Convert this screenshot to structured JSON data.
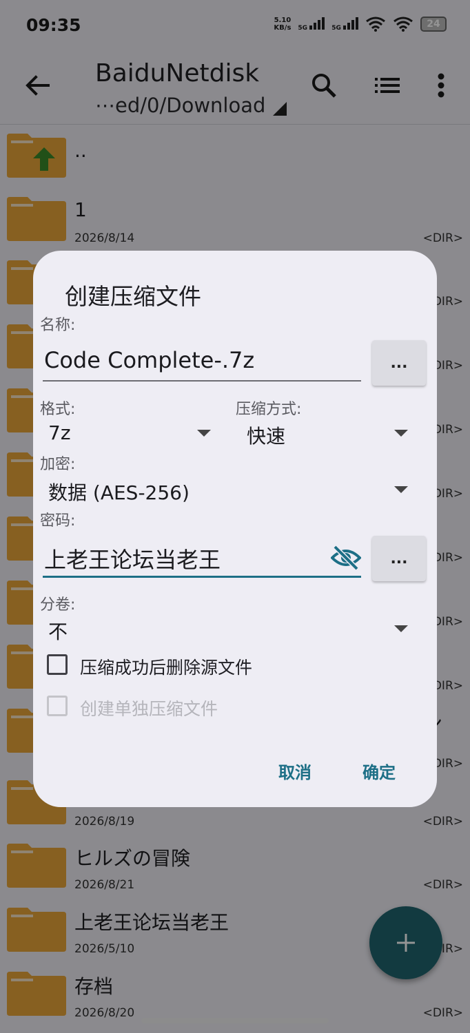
{
  "status_bar": {
    "time": "09:35",
    "net_speed_value": "5.10",
    "net_speed_unit": "KB/s",
    "signal1": "5G",
    "signal2": "5G",
    "battery": "24"
  },
  "toolbar": {
    "title": "BaiduNetdisk",
    "path": "⋯ed/0/Download",
    "icons": [
      "back-arrow-icon",
      "search-icon",
      "list-view-icon",
      "more-vert-icon"
    ]
  },
  "files": [
    {
      "name": "..",
      "date": "",
      "tag": ""
    },
    {
      "name": "1",
      "date": "2026/8/14",
      "tag": "<DIR>"
    },
    {
      "name": "",
      "date": "",
      "tag": "<DIR>"
    },
    {
      "name": "",
      "date": "",
      "tag": "<DIR>"
    },
    {
      "name": "",
      "date": "",
      "tag": "<DIR>"
    },
    {
      "name": "",
      "date": "",
      "tag": "<DIR>"
    },
    {
      "name": "",
      "date": "",
      "tag": "<DIR>"
    },
    {
      "name": "",
      "date": "",
      "tag": "<DIR>"
    },
    {
      "name": "ン",
      "date": "",
      "tag": "<DIR>"
    },
    {
      "name": "",
      "date": "",
      "tag": "<DIR>"
    },
    {
      "name": "",
      "date": "2026/8/19",
      "tag": "<DIR>"
    },
    {
      "name": "ヒルズの冒険",
      "date": "2026/8/21",
      "tag": "<DIR>"
    },
    {
      "name": "上老王论坛当老王",
      "date": "2026/5/10",
      "tag": "<DIR>"
    },
    {
      "name": "存档",
      "date": "2026/8/20",
      "tag": "<DIR>"
    }
  ],
  "dialog": {
    "title": "创建压缩文件",
    "name_label": "名称:",
    "name_value": "Code Complete-.7z",
    "dots": "...",
    "format_label": "格式:",
    "format_value": "7z",
    "method_label": "压缩方式:",
    "method_value": "快速",
    "encrypt_label": "加密:",
    "encrypt_value": "数据 (AES-256)",
    "password_label": "密码:",
    "password_value": "上老王论坛当老王",
    "split_label": "分卷:",
    "split_value": "不",
    "delete_source_label": "压缩成功后删除源文件",
    "delete_source_checked": false,
    "separate_label": "创建单独压缩文件",
    "separate_enabled": false,
    "cancel_label": "取消",
    "ok_label": "确定"
  },
  "colors": {
    "accent": "#1d6f86",
    "fab": "#20656f",
    "folder": "#e8a53a"
  }
}
